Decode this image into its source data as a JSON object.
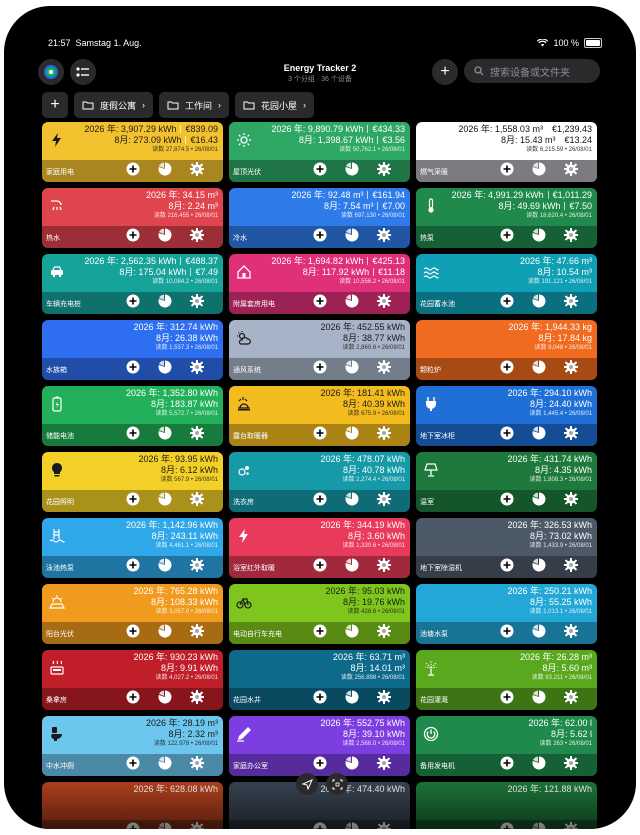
{
  "status": {
    "time": "21:57",
    "date": "Samstag 1. Aug.",
    "battery": "100 %"
  },
  "header": {
    "title": "Energy Tracker 2",
    "subtitle": "3 个分组 · 36 个设备",
    "search_placeholder": "搜索设备或文件夹"
  },
  "folders": [
    {
      "label": "度假公寓"
    },
    {
      "label": "工作间"
    },
    {
      "label": "花园小屋"
    }
  ],
  "cards": [
    {
      "name": "家庭用电",
      "icon": "bolt-icon",
      "color": "#f2c12e",
      "year": "2026 年: 3,907.29 kWh",
      "year_cost": "€839.09",
      "month": "8月: 273.09 kWh",
      "month_cost": "€16.43",
      "reading": "读数 27,874.5 • 26/08/01",
      "dark_text": true
    },
    {
      "name": "屋顶光伏",
      "icon": "sun-icon",
      "color": "#2fa866",
      "year": "2026 年: 9,890.79 kWh",
      "year_cost": "€434.33",
      "month": "8月: 1,398.67 kWh",
      "month_cost": "€3.56",
      "reading": "读数 50,762.1 • 26/08/01"
    },
    {
      "name": "燃气采暖",
      "icon": "flame-icon",
      "color": "#ffffff",
      "year": "2026 年: 1,558.03 m³",
      "year_cost": "€1,239.43",
      "month": "8月: 15.43 m³",
      "month_cost": "€13.24",
      "reading": "读数 6,215.59 • 26/08/01",
      "white": true
    },
    {
      "name": "热水",
      "icon": "shower-icon",
      "color": "#e0444c",
      "year": "2026 年: 34.15 m³",
      "month": "8月: 2.24 m³",
      "reading": "读数 216.455 • 26/08/01"
    },
    {
      "name": "冷水",
      "icon": "drops-icon",
      "color": "#2f7bea",
      "year": "2026 年: 92.48 m³",
      "year_cost": "€161.94",
      "month": "8月: 7.54 m³",
      "month_cost": "€7.00",
      "reading": "读数 697.130 • 26/08/01"
    },
    {
      "name": "热泵",
      "icon": "thermometer-icon",
      "color": "#1f8a4c",
      "year": "2026 年: 4,991.29 kWh",
      "year_cost": "€1,011.29",
      "month": "8月: 49.69 kWh",
      "month_cost": "€7.50",
      "reading": "读数 18,620.4 • 26/08/01"
    },
    {
      "name": "车辆充电桩",
      "icon": "car-icon",
      "color": "#16a39a",
      "year": "2026 年: 2,562.35 kWh",
      "year_cost": "€488.37",
      "month": "8月: 175.04 kWh",
      "month_cost": "€7.49",
      "reading": "读数 10,084.2 • 26/08/01"
    },
    {
      "name": "附属套房用电",
      "icon": "house-icon",
      "color": "#e0307a",
      "year": "2026 年: 1,694.82 kWh",
      "year_cost": "€425.13",
      "month": "8月: 117.92 kWh",
      "month_cost": "€11.18",
      "reading": "读数 10,556.2 • 26/08/01"
    },
    {
      "name": "花园蓄水池",
      "icon": "waves-icon",
      "color": "#0fa0b5",
      "year": "2026 年: 47.66 m³",
      "month": "8月: 10.54 m³",
      "reading": "读数 191.121 • 26/08/01"
    },
    {
      "name": "水族箱",
      "icon": "drop-icon",
      "color": "#2d6ff0",
      "year": "2026 年: 312.74 kWh",
      "month": "8月: 26.38 kWh",
      "reading": "读数 1,537.3 • 26/08/01"
    },
    {
      "name": "通风系统",
      "icon": "cloud-sun-icon",
      "color": "#a7b3c6",
      "year": "2026 年: 452.55 kWh",
      "month": "8月: 38.77 kWh",
      "reading": "读数 2,860.6 • 26/08/01",
      "dark_text": true
    },
    {
      "name": "颗粒炉",
      "icon": "fire-icon",
      "color": "#f06a1f",
      "year": "2026 年: 1,944.33 kg",
      "month": "8月: 17.84 kg",
      "reading": "读数 9,048 • 26/08/01"
    },
    {
      "name": "储能电池",
      "icon": "battery-icon",
      "color": "#23b05a",
      "year": "2026 年: 1,352.80 kWh",
      "month": "8月: 183.87 kWh",
      "reading": "读数 5,572.7 • 26/08/01"
    },
    {
      "name": "露台取暖器",
      "icon": "heater-icon",
      "color": "#f2bc1e",
      "year": "2026 年: 181.41 kWh",
      "month": "8月: 40.39 kWh",
      "reading": "读数 675.9 • 26/08/01",
      "dark_text": true
    },
    {
      "name": "地下室冰柜",
      "icon": "plug-icon",
      "color": "#1f6fd6",
      "year": "2026 年: 294.10 kWh",
      "month": "8月: 24.40 kWh",
      "reading": "读数 1,445.4 • 26/08/01"
    },
    {
      "name": "花园照明",
      "icon": "bulb-icon",
      "color": "#f2d028",
      "year": "2026 年: 93.95 kWh",
      "month": "8月: 6.12 kWh",
      "reading": "读数 567.9 • 26/08/01",
      "dark_text": true
    },
    {
      "name": "洗衣房",
      "icon": "bubbles-icon",
      "color": "#169aa8",
      "year": "2026 年: 478.07 kWh",
      "month": "8月: 40.78 kWh",
      "reading": "读数 2,274.4 • 26/08/01"
    },
    {
      "name": "温室",
      "icon": "lamp-icon",
      "color": "#1e7a3c",
      "year": "2026 年: 431.74 kWh",
      "month": "8月: 4.35 kWh",
      "reading": "读数 1,808.3 • 26/08/01"
    },
    {
      "name": "泳池热泵",
      "icon": "pool-icon",
      "color": "#2fa7e8",
      "year": "2026 年: 1,142.96 kWh",
      "month": "8月: 243.11 kWh",
      "reading": "读数 4,461.1 • 26/08/01"
    },
    {
      "name": "浴室红外取暖",
      "icon": "bolt-icon",
      "color": "#e83a5a",
      "year": "2026 年: 344.19 kWh",
      "month": "8月: 3.60 kWh",
      "reading": "读数 1,330.6 • 26/08/01"
    },
    {
      "name": "地下室除湿机",
      "icon": "drops-icon",
      "color": "#4c5a68",
      "year": "2026 年: 326.53 kWh",
      "month": "8月: 73.02 kWh",
      "reading": "读数 1,433.9 • 26/08/01"
    },
    {
      "name": "阳台光伏",
      "icon": "solar-icon",
      "color": "#f09a1e",
      "year": "2026 年: 765.28 kWh",
      "month": "8月: 108.33 kWh",
      "reading": "读数 3,057.0 • 26/08/01"
    },
    {
      "name": "电动自行车充电",
      "icon": "bike-icon",
      "color": "#7ec61e",
      "year": "2026 年: 95.03 kWh",
      "month": "8月: 19.76 kWh",
      "reading": "读数 428.6 • 26/08/01",
      "dark_text": true
    },
    {
      "name": "池塘水泵",
      "icon": "drop-icon",
      "color": "#23a7d6",
      "year": "2026 年: 250.21 kWh",
      "month": "8月: 55.25 kWh",
      "reading": "读数 1,013.1 • 26/08/01"
    },
    {
      "name": "桑拿房",
      "icon": "sauna-icon",
      "color": "#c01f2a",
      "year": "2026 年: 930.23 kWh",
      "month": "8月: 9.91 kWh",
      "reading": "读数 4,027.2 • 26/08/01"
    },
    {
      "name": "花园水井",
      "icon": "drops-icon",
      "color": "#0e6a8a",
      "year": "2026 年: 63.71 m³",
      "month": "8月: 14.01 m³",
      "reading": "读数 256.898 • 26/08/01"
    },
    {
      "name": "花园灌溉",
      "icon": "sprinkler-icon",
      "color": "#5aa81e",
      "year": "2026 年: 26.28 m³",
      "month": "8月: 5.60 m³",
      "reading": "读数 93.211 • 26/08/01"
    },
    {
      "name": "中水冲厕",
      "icon": "toilet-icon",
      "color": "#6cc6ee",
      "year": "2026 年: 28.19 m³",
      "month": "8月: 2.32 m³",
      "reading": "读数 122.978 • 26/08/01",
      "dark_text": true
    },
    {
      "name": "家庭办公室",
      "icon": "pen-icon",
      "color": "#7c3ee0",
      "year": "2026 年: 552.75 kWh",
      "month": "8月: 39.10 kWh",
      "reading": "读数 2,566.0 • 26/08/01"
    },
    {
      "name": "备用发电机",
      "icon": "power-icon",
      "color": "#1f8a4c",
      "year": "2026 年: 62.00 l",
      "month": "8月: 5.62 l",
      "reading": "读数 263 • 26/08/01"
    },
    {
      "name": "",
      "icon": "",
      "color": "#b8421e",
      "year": "2026 年: 628.08 kWh",
      "month": "",
      "reading": ""
    },
    {
      "name": "",
      "icon": "",
      "color": "#3b4654",
      "year": "2026 年: 474.40 kWh",
      "month": "",
      "reading": ""
    },
    {
      "name": "",
      "icon": "",
      "color": "#1e7a3c",
      "year": "2026 年: 121.88 kWh",
      "month": "",
      "reading": ""
    }
  ]
}
